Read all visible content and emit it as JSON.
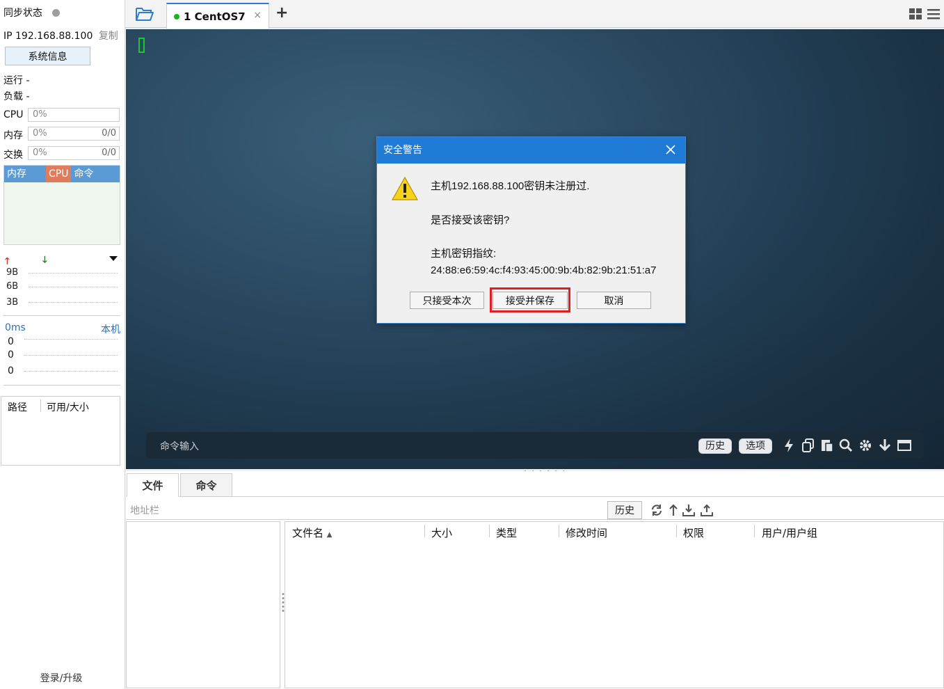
{
  "sidebar": {
    "sync_label": "同步状态",
    "ip_label": "IP 192.168.88.100",
    "copy_label": "复制",
    "sysinfo_button": "系统信息",
    "run_label": "运行 -",
    "load_label": "负载 -",
    "cpu": {
      "label": "CPU",
      "value": "0%"
    },
    "mem": {
      "label": "内存",
      "value": "0%",
      "right": "0/0"
    },
    "swap": {
      "label": "交换",
      "value": "0%",
      "right": "0/0"
    },
    "monitor_tabs": [
      "内存",
      "CPU",
      "命令"
    ],
    "net_labels": [
      "9B",
      "6B",
      "3B"
    ],
    "latency": {
      "ms": "0ms",
      "host": "本机",
      "values": [
        "0",
        "0",
        "0"
      ]
    },
    "paths_headers": [
      "路径",
      "可用/大小"
    ],
    "login": "登录/升级"
  },
  "tabbar": {
    "tab_title": "1 CentOS7",
    "close": "×",
    "add": "+"
  },
  "terminal": {
    "cmd_placeholder": "命令输入",
    "history_btn": "历史",
    "options_btn": "选项"
  },
  "dialog": {
    "title": "安全警告",
    "line1": "主机192.168.88.100密钥未注册过.",
    "line2": "是否接受该密钥?",
    "line3": "主机密钥指纹:",
    "fingerprint": "24:88:e6:59:4c:f4:93:45:00:9b:4b:82:9b:21:51:a7",
    "btn_once": "只接受本次",
    "btn_save": "接受并保存",
    "btn_cancel": "取消"
  },
  "bottom": {
    "tabs": [
      "文件",
      "命令"
    ],
    "address_placeholder": "地址栏",
    "history_btn": "历史",
    "columns": [
      "文件名",
      "大小",
      "类型",
      "修改时间",
      "权限",
      "用户/用户组"
    ]
  },
  "colors": {
    "accent": "#1f7bd6",
    "highlight": "#e21b24",
    "status_green": "#17b31b"
  }
}
